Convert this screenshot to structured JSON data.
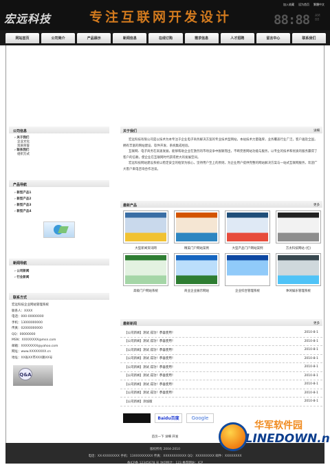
{
  "header": {
    "logo": "宏远科技",
    "slogan": "专注互联网开发设计",
    "top_links": [
      "加入收藏",
      "设为首页",
      "繁體中文"
    ],
    "clock": "88:88",
    "ampm_top": "AM",
    "ampm_bottom": "88"
  },
  "nav": [
    "网站首页",
    "公司简介",
    "产品展示",
    "新闻信息",
    "在线订购",
    "需求信息",
    "人才招聘",
    "留言中心",
    "联系我们"
  ],
  "sidebar": {
    "company": {
      "title": "公司信息",
      "items": [
        {
          "label": "关于我们",
          "bold": true
        },
        {
          "label": "企业文化",
          "bold": false
        },
        {
          "label": "资质荣誉",
          "bold": false
        },
        {
          "label": "联系我们",
          "bold": true
        },
        {
          "label": "组织方式",
          "bold": false
        }
      ]
    },
    "products": {
      "title": "产品导航",
      "items": [
        "新型产品1",
        "新型产品2",
        "新型产品3",
        "新型产品4"
      ]
    },
    "news": {
      "title": "新闻导航",
      "items": [
        "公司新闻",
        "行业新闻"
      ]
    },
    "contact": {
      "title": "联系方式",
      "lines": [
        "宏远科技企业网站管理系统",
        "联系人：XXXX",
        "电话：000-00000000",
        "手机：13000000000",
        "传真：02000000000",
        "QQ：00000000",
        "MSN：XXXXXXXX@msn.com",
        "邮箱：XXXXXXXX@yahoo.com",
        "网址：www.XXXXXXXX.cn",
        "地址：XX省XX市XXX路XX号"
      ]
    }
  },
  "about": {
    "title": "关于我们",
    "more": "详细",
    "paragraphs": [
      "宏远科技有限公司是以技术为本专注于企业电子商务解决方案的专业技术型网站，本站技术力量雄厚，业务覆盖行业广泛，客户遍及全国，拥有丰富的网站建设、软件开发、系统集成经验。",
      "互联网、电子商务在高速发展，能够帮助企业在激烈的市场竞争中脱颖而出，不断完善网站功能与服务，以专业的技术和优质的服务赢得了客户的信赖，使企业在互联网时代获得更大的发展空间。",
      "宏远科技网站建设系统以稳定安全的框架为核心，坚持用户至上的原则，为企业用户提供完整的网站解决方案与一站式互联网服务，欢迎广大客户来电咨询合作洽谈。"
    ]
  },
  "products": {
    "title": "最新产品",
    "more": "更多",
    "items": [
      {
        "label": "大型新闻资讯网",
        "colors": [
          "#3a6ea5",
          "#c9d9ec",
          "#f1c232"
        ]
      },
      {
        "label": "精美门户网站案例",
        "colors": [
          "#d35400",
          "#f5e6d3",
          "#2e86c1"
        ]
      },
      {
        "label": "大型产品门户网站案例",
        "colors": [
          "#1f4e79",
          "#dfe9f5",
          "#e74c3c"
        ]
      },
      {
        "label": "方太科技网站 (红)",
        "colors": [
          "#222222",
          "#f2f2f2",
          "#8e8e8e"
        ]
      },
      {
        "label": "高级门户网站系统",
        "colors": [
          "#2e7d32",
          "#e3f2e1",
          "#a5d6a7"
        ]
      },
      {
        "label": "商业企业展示网站",
        "colors": [
          "#1565c0",
          "#bbdefb",
          "#2e7d32"
        ]
      },
      {
        "label": "企业综合管理系统",
        "colors": [
          "#0d47a1",
          "#90caf9",
          "#ffffff"
        ]
      },
      {
        "label": "休闲娱乐管理系统",
        "colors": [
          "#37474f",
          "#cfd8dc",
          "#4fc3f7"
        ]
      }
    ]
  },
  "news": {
    "title": "最新新闻",
    "more": "更多",
    "items": [
      {
        "text": "【公司新闻】测试 成功！恭喜使用！",
        "date": "2010-8-1"
      },
      {
        "text": "【公司新闻】测试 成功！恭喜使用！",
        "date": "2010-8-1"
      },
      {
        "text": "【公司新闻】测试 成功！恭喜使用！",
        "date": "2010-8-1"
      },
      {
        "text": "【公司新闻】测试 成功！恭喜使用！",
        "date": "2010-8-1"
      },
      {
        "text": "【公司新闻】测试 成功！恭喜使用！",
        "date": "2010-8-1"
      },
      {
        "text": "【公司新闻】测试 成功！恭喜使用！",
        "date": "2010-8-1"
      },
      {
        "text": "【公司新闻】测试 成功！恭喜使用！",
        "date": "2010-8-1"
      },
      {
        "text": "【公司新闻】测试 成功！恭喜使用！",
        "date": "2010-8-1"
      },
      {
        "text": "【公司新闻】添加版",
        "date": "2010-8-1"
      }
    ]
  },
  "partners": [
    "Baidu百度",
    "Google"
  ],
  "footer_links": "首页一下  详细 开发",
  "footer": {
    "copyright": "版权所有 2004-2010",
    "contact": "电话：XX-XXXXXXXX 手机：13XXXXXXXXX 传真：XXXXXXXXXXX QQ：XXXXXXXXX 邮件：XXXXXXXX",
    "stats": "备ICP备 12345678 号 访问统计：123 推荐网站：ICP"
  },
  "watermark": {
    "top": "华军软件园",
    "bottom": "ONLINEDOWN.net"
  }
}
